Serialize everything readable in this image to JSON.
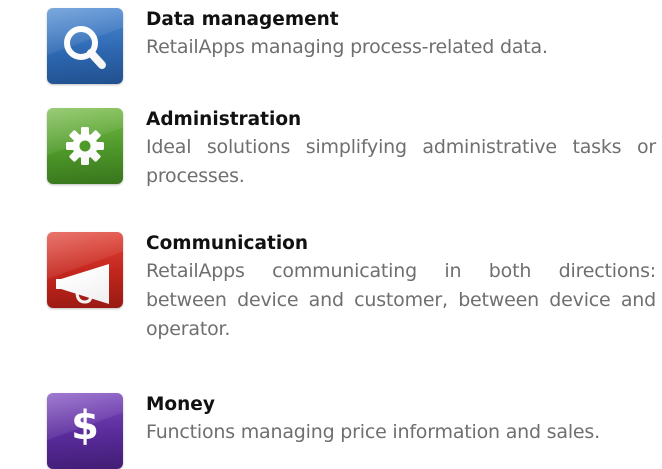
{
  "categories": [
    {
      "title": "Data management",
      "description": "RetailApps managing process-related data.",
      "icon": "magnifier-icon",
      "color": "#2f6ab5"
    },
    {
      "title": "Administration",
      "description": "Ideal solutions simplifying administrative tasks or processes.",
      "icon": "gear-icon",
      "color": "#4f9a2a"
    },
    {
      "title": "Communication",
      "description": "RetailApps communicating in both directions: between device and customer, between device and operator.",
      "icon": "megaphone-icon",
      "color": "#c4261d"
    },
    {
      "title": "Money",
      "description": "Functions managing price information and sales.",
      "icon": "dollar-icon",
      "color": "#5a2b9c"
    }
  ]
}
